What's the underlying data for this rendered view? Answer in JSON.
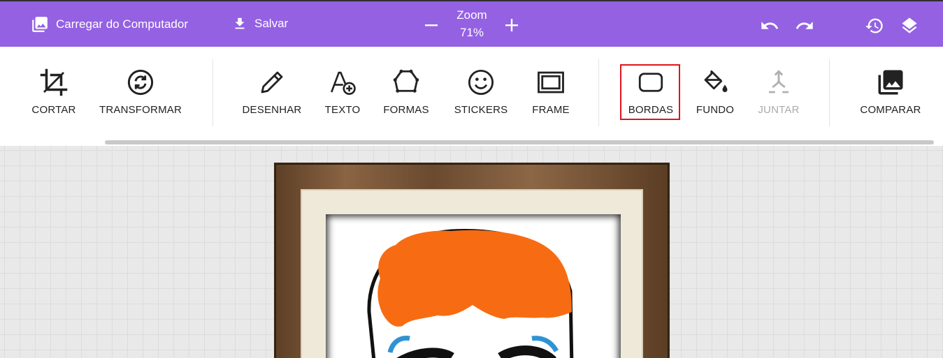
{
  "header": {
    "upload_label": "Carregar do Computador",
    "save_label": "Salvar",
    "zoom_label": "Zoom",
    "zoom_value": "71%"
  },
  "toolbar": {
    "items": [
      {
        "label": "CORTAR",
        "icon": "crop-icon"
      },
      {
        "label": "TRANSFORMAR",
        "icon": "transform-icon"
      },
      {
        "label": "DESENHAR",
        "icon": "pencil-icon"
      },
      {
        "label": "TEXTO",
        "icon": "text-add-icon"
      },
      {
        "label": "FORMAS",
        "icon": "shapes-icon"
      },
      {
        "label": "STICKERS",
        "icon": "smiley-icon"
      },
      {
        "label": "FRAME",
        "icon": "frame-icon"
      },
      {
        "label": "BORDAS",
        "icon": "rounded-border-icon"
      },
      {
        "label": "FUNDO",
        "icon": "paint-bucket-icon"
      },
      {
        "label": "JUNTAR",
        "icon": "merge-icon"
      },
      {
        "label": "COMPARAR",
        "icon": "compare-icon"
      }
    ]
  },
  "colors": {
    "header_bg": "#9461e3",
    "highlight": "#e0141e",
    "hair": "#f76c12",
    "brow": "#2f93d3"
  }
}
